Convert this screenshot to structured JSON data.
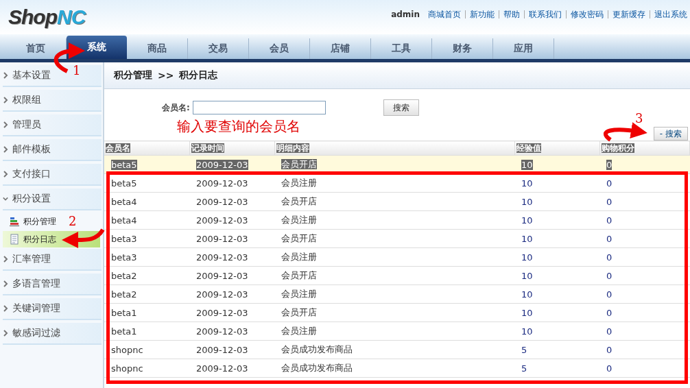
{
  "logo": {
    "dark": "Shop",
    "accent": "NC"
  },
  "user": "admin",
  "top_links": [
    "商城首页",
    "新功能",
    "帮助",
    "联系我们",
    "修改密码",
    "更新缓存",
    "退出系统"
  ],
  "tabs": [
    {
      "label": "首页",
      "selected": false
    },
    {
      "label": "系统",
      "selected": true
    },
    {
      "label": "商品",
      "selected": false
    },
    {
      "label": "交易",
      "selected": false
    },
    {
      "label": "会员",
      "selected": false
    },
    {
      "label": "店铺",
      "selected": false
    },
    {
      "label": "工具",
      "selected": false
    },
    {
      "label": "财务",
      "selected": false
    },
    {
      "label": "应用",
      "selected": false
    }
  ],
  "sidebar": {
    "items": [
      {
        "label": "基本设置",
        "expanded": false
      },
      {
        "label": "权限组",
        "expanded": false
      },
      {
        "label": "管理员",
        "expanded": false
      },
      {
        "label": "邮件模板",
        "expanded": false
      },
      {
        "label": "支付接口",
        "expanded": false
      },
      {
        "label": "积分设置",
        "expanded": true,
        "children": [
          {
            "label": "积分管理",
            "kind": "chart",
            "selected": false
          },
          {
            "label": "积分日志",
            "kind": "document",
            "selected": true
          }
        ]
      },
      {
        "label": "汇率管理",
        "expanded": false
      },
      {
        "label": "多语言管理",
        "expanded": false
      },
      {
        "label": "关键词管理",
        "expanded": false
      },
      {
        "label": "敏感词过滤",
        "expanded": false
      }
    ]
  },
  "breadcrumb": [
    "积分管理",
    ">>",
    "积分日志"
  ],
  "search": {
    "label": "会员名:",
    "button": "搜索",
    "toggle": "- 搜索"
  },
  "table": {
    "columns": [
      "会员名",
      "记录时间",
      "明细内容",
      "经验值",
      "购物积分"
    ],
    "rows": [
      {
        "cells": [
          "beta5",
          "2009-12-03",
          "会员开店",
          "10",
          "0"
        ],
        "selected": true
      },
      {
        "cells": [
          "beta5",
          "2009-12-03",
          "会员注册",
          "10",
          "0"
        ],
        "selected": false
      },
      {
        "cells": [
          "beta4",
          "2009-12-03",
          "会员开店",
          "10",
          "0"
        ],
        "selected": false
      },
      {
        "cells": [
          "beta4",
          "2009-12-03",
          "会员注册",
          "10",
          "0"
        ],
        "selected": false
      },
      {
        "cells": [
          "beta3",
          "2009-12-03",
          "会员开店",
          "10",
          "0"
        ],
        "selected": false
      },
      {
        "cells": [
          "beta3",
          "2009-12-03",
          "会员注册",
          "10",
          "0"
        ],
        "selected": false
      },
      {
        "cells": [
          "beta2",
          "2009-12-03",
          "会员开店",
          "10",
          "0"
        ],
        "selected": false
      },
      {
        "cells": [
          "beta2",
          "2009-12-03",
          "会员注册",
          "10",
          "0"
        ],
        "selected": false
      },
      {
        "cells": [
          "beta1",
          "2009-12-03",
          "会员开店",
          "10",
          "0"
        ],
        "selected": false
      },
      {
        "cells": [
          "beta1",
          "2009-12-03",
          "会员注册",
          "10",
          "0"
        ],
        "selected": false
      },
      {
        "cells": [
          "shopnc",
          "2009-12-03",
          "会员成功发布商品",
          "5",
          "0"
        ],
        "selected": false
      },
      {
        "cells": [
          "shopnc",
          "2009-12-03",
          "会员成功发布商品",
          "5",
          "0"
        ],
        "selected": false
      }
    ]
  },
  "annotations": {
    "hint": "输入要查询的会员名",
    "numbers": [
      "1",
      "2",
      "3"
    ]
  }
}
